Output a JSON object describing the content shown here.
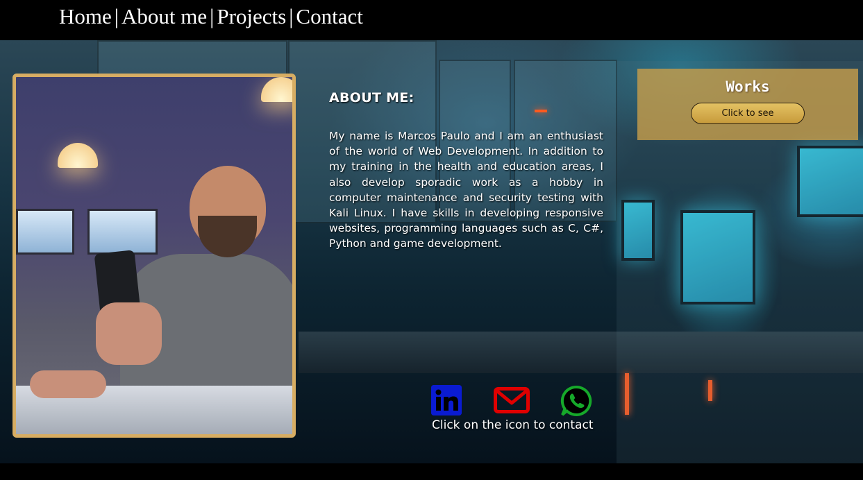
{
  "nav": {
    "items": [
      {
        "label": "Home"
      },
      {
        "label": "About me"
      },
      {
        "label": "Projects"
      },
      {
        "label": "Contact"
      }
    ],
    "separator": "|"
  },
  "about": {
    "title": "ABOUT ME:",
    "text": "My name is Marcos Paulo and I am an enthusiast of the world of Web Development. In addition to my training in the health and education areas, I also develop sporadic work as a hobby in computer maintenance and security testing with Kali Linux. I have skills in developing responsive websites, programming languages such as C, C#, Python and game development."
  },
  "works": {
    "title": "Works",
    "button_label": "Click to see"
  },
  "contact": {
    "icons": [
      "linkedin-icon",
      "mail-icon",
      "whatsapp-icon"
    ],
    "caption": "Click on the icon to contact"
  },
  "colors": {
    "frame_gold": "#d7ad63",
    "works_bg": "#c49c4a",
    "linkedin": "#0a1bd1",
    "mail": "#e00000",
    "whatsapp": "#16a82a"
  }
}
